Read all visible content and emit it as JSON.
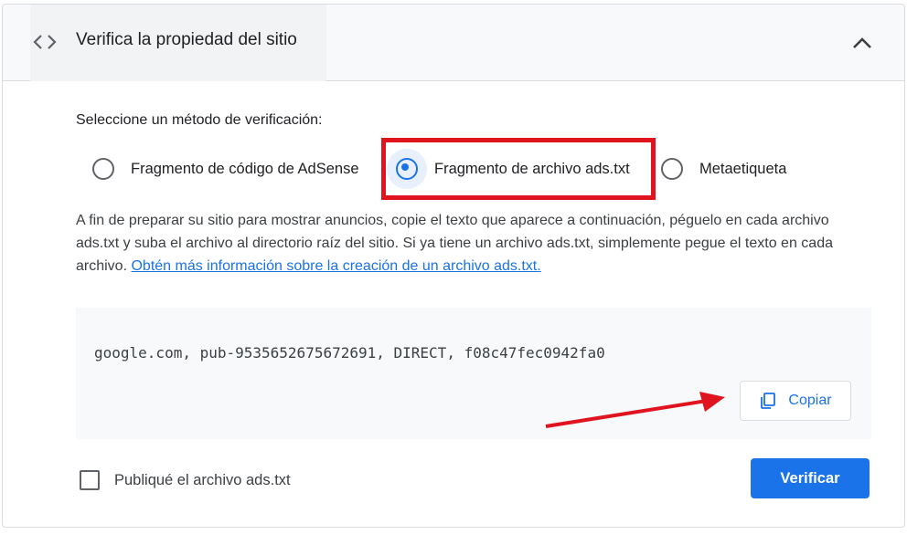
{
  "header": {
    "title": "Verifica la propiedad del sitio",
    "left_icon": "code-icon",
    "right_icon": "chevron-up-icon"
  },
  "method": {
    "prompt": "Seleccione un método de verificación:",
    "options": [
      {
        "label": "Fragmento de código de AdSense",
        "selected": false
      },
      {
        "label": "Fragmento de archivo ads.txt",
        "selected": true
      },
      {
        "label": "Metaetiqueta",
        "selected": false
      }
    ]
  },
  "description": {
    "text": "A fin de preparar su sitio para mostrar anuncios, copie el texto que aparece a continuación, péguelo en cada archivo ads.txt y suba el archivo al directorio raíz del sitio. Si ya tiene un archivo ads.txt, simplemente pegue el texto en cada archivo. ",
    "link": "Obtén más información sobre la creación de un archivo ads.txt."
  },
  "snippet": {
    "code": "google.com, pub-9535652675672691, DIRECT, f08c47fec0942fa0",
    "copy_label": "Copiar",
    "copy_icon": "copy-icon"
  },
  "footer": {
    "checkbox_label": "Publiqué el archivo ads.txt",
    "checkbox_checked": false,
    "verify_label": "Verificar"
  },
  "colors": {
    "accent": "#1a73e8",
    "annotation": "#e0141e",
    "header_bg": "#f8f9fa"
  }
}
